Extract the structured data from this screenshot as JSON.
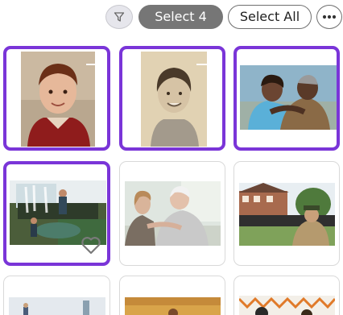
{
  "toolbar": {
    "filter_icon": "filter-icon",
    "select_label": "Select 4",
    "select_all_label": "Select All",
    "more_icon": "more-options-icon"
  },
  "colors": {
    "selection_border": "#7a35d8",
    "select_pill_bg": "#767676",
    "tile_border": "#d9d9d9"
  },
  "photos": [
    {
      "name": "boy-portrait",
      "selected": true
    },
    {
      "name": "girl-portrait-sepia",
      "selected": true
    },
    {
      "name": "couple-hugging",
      "selected": true
    },
    {
      "name": "waterfall-hikers",
      "selected": true,
      "favorite_icon": "heart-icon"
    },
    {
      "name": "girl-with-grandmother",
      "selected": false
    },
    {
      "name": "parade-crowd",
      "selected": false
    },
    {
      "name": "partial-photo-1",
      "selected": false
    },
    {
      "name": "partial-photo-2",
      "selected": false
    },
    {
      "name": "partial-photo-3",
      "selected": false
    }
  ]
}
